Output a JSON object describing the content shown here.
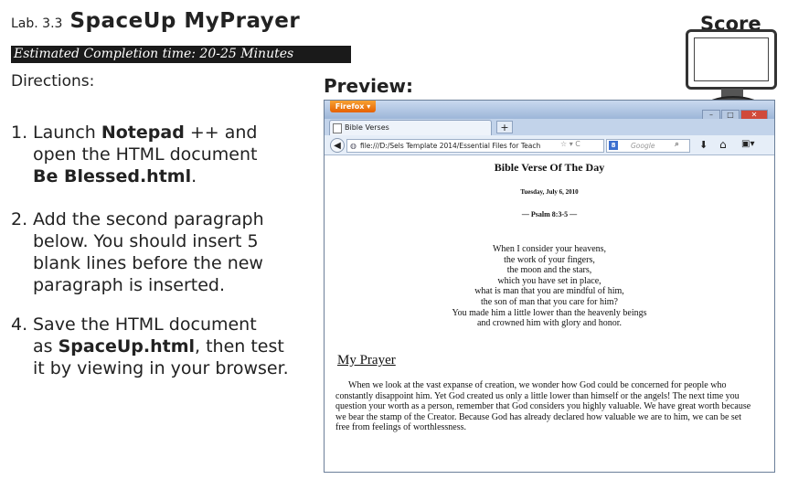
{
  "header": {
    "lab_number": "Lab. 3.3",
    "lab_title": "SpaceUp MyPrayer",
    "completion_time": "Estimated Completion time: 20-25 Minutes",
    "directions_label": "Directions:",
    "preview_label": "Preview:",
    "score_label": "Score"
  },
  "steps": [
    {
      "num": "1.",
      "parts": [
        "Launch ",
        "Notepad",
        " ++ and",
        "open the HTML document",
        "Be Blessed.html",
        "."
      ]
    },
    {
      "num": "2.",
      "lines": [
        "Add the second paragraph",
        "below. You should insert 5",
        "blank lines before the new",
        "paragraph is inserted."
      ]
    },
    {
      "num": "4.",
      "parts": [
        "Save the HTML document",
        "as ",
        "SpaceUp.html",
        ", then test",
        "it by viewing in your browser."
      ]
    }
  ],
  "browser": {
    "app_button": "Firefox",
    "tab_title": "Bible Verses",
    "new_tab": "+",
    "url": "file:///D:/Sels Template 2014/Essential Files for Teach",
    "search_placeholder": "Google",
    "page": {
      "heading": "Bible Verse Of The Day",
      "date": "Tuesday, July 6, 2010",
      "reference": "— Psalm 8:3-5 —",
      "verse_lines": [
        "When I consider your heavens,",
        "the work of your fingers,",
        "the moon and the stars,",
        "which you have set in place,",
        "what is man that you are mindful of him,",
        "the son of man that you care for him?",
        "You made him a little lower than the heavenly beings",
        "and crowned him with glory and honor."
      ],
      "prayer_heading": "My Prayer",
      "prayer_text": "When we look at the vast expanse of creation, we wonder how God could be concerned for people who constantly disappoint him. Yet God created us only a little lower than himself or the angels! The next time you question your worth as a person, remember that God considers you highly valuable. We have great worth because we bear the stamp of the Creator. Because God has already declared how valuable we are to him, we can be set free from feelings of worthlessness."
    }
  }
}
